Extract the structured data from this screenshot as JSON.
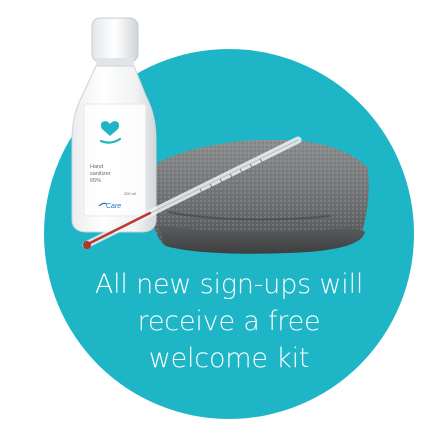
{
  "promo": {
    "headline": "All new sign-ups will receive a free welcome kit",
    "background_color": "#1eb6c6",
    "text_color": "#ffffff"
  },
  "kit_items": [
    {
      "name": "hand-sanitizer-bottle"
    },
    {
      "name": "thermometer"
    },
    {
      "name": "grey-towel"
    }
  ],
  "bottle_label": {
    "line1": "Hand",
    "line2": "sanitizer",
    "line3": "65%",
    "volume": "200 ml",
    "brand": "Care"
  }
}
